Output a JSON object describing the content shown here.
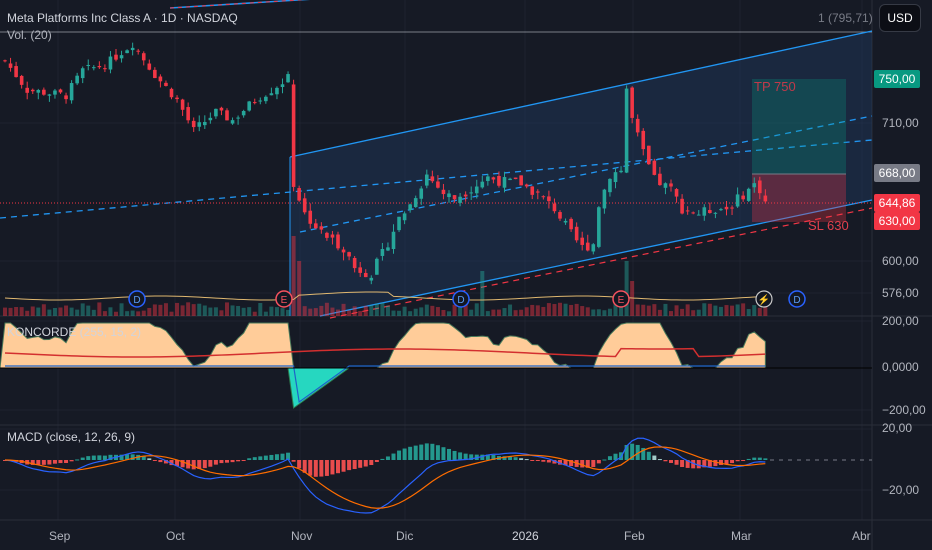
{
  "header": {
    "title": "Meta Platforms Inc Class A · 1D · NASDAQ",
    "volume_label": "Vol. (20)",
    "line_label": "1 (795,71)",
    "currency": "USD"
  },
  "position": {
    "tp_label": "TP 750",
    "sl_label": "SL 630"
  },
  "price_axis": {
    "ticks": [
      "710,00",
      "600,00",
      "576,00"
    ],
    "tags": {
      "tp": "750,00",
      "entry": "668,00",
      "last": "644,86",
      "sl": "630,00"
    }
  },
  "koncorde": {
    "label": "KONCORDE (255, 15, 2)",
    "ticks": [
      "200,00",
      "0,0000",
      "−200,00"
    ]
  },
  "macd": {
    "label": "MACD (close, 12, 26, 9)",
    "ticks": [
      "20,00",
      "−20,00"
    ]
  },
  "time_axis": [
    "Sep",
    "Oct",
    "Nov",
    "Dic",
    "2026",
    "Feb",
    "Mar",
    "Abr"
  ],
  "colors": {
    "up": "#26a69a",
    "down": "#f23645",
    "channel": "#2196f3",
    "bg": "#161a25"
  },
  "chart_data": {
    "type": "candlestick",
    "close_path": [
      [
        0,
        767
      ],
      [
        4,
        740
      ],
      [
        11,
        735
      ],
      [
        14,
        758
      ],
      [
        18,
        763
      ],
      [
        23,
        783
      ],
      [
        27,
        754
      ],
      [
        31,
        731
      ],
      [
        34,
        704
      ],
      [
        38,
        720
      ],
      [
        41,
        713
      ],
      [
        45,
        731
      ],
      [
        48,
        740
      ],
      [
        51,
        751
      ],
      [
        52,
        660
      ],
      [
        54,
        636
      ],
      [
        57,
        621
      ],
      [
        61,
        610
      ],
      [
        63,
        595
      ],
      [
        66,
        591
      ],
      [
        68,
        605
      ],
      [
        71,
        632
      ],
      [
        73,
        643
      ],
      [
        76,
        667
      ],
      [
        79,
        652
      ],
      [
        81,
        648
      ],
      [
        84,
        656
      ],
      [
        87,
        665
      ],
      [
        89,
        662
      ],
      [
        93,
        660
      ],
      [
        96,
        651
      ],
      [
        99,
        640
      ],
      [
        102,
        620
      ],
      [
        104,
        610
      ],
      [
        106,
        613
      ],
      [
        107,
        643
      ],
      [
        109,
        667
      ],
      [
        111,
        671
      ],
      [
        112,
        741
      ],
      [
        113,
        714
      ],
      [
        115,
        685
      ],
      [
        117,
        663
      ],
      [
        120,
        655
      ],
      [
        122,
        640
      ],
      [
        125,
        636
      ],
      [
        128,
        640
      ],
      [
        130,
        640
      ],
      [
        133,
        651
      ],
      [
        135,
        659
      ],
      [
        136,
        655
      ],
      [
        137,
        645
      ]
    ],
    "events": [
      "D",
      "E",
      "D",
      "E",
      "D"
    ]
  }
}
